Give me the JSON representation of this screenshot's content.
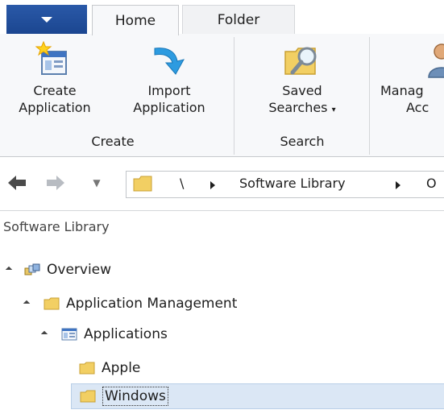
{
  "ribbon": {
    "tabs": [
      "Home",
      "Folder"
    ],
    "buttons": {
      "create_application": [
        "Create",
        "Application"
      ],
      "import_application": [
        "Import",
        "Application"
      ],
      "saved_searches": [
        "Saved",
        "Searches"
      ],
      "manage_access": [
        "Manag",
        "Acc"
      ]
    },
    "groups": [
      "Create",
      "Search"
    ]
  },
  "address_bar": {
    "root": "\\",
    "crumbs": [
      "Software Library",
      "O"
    ]
  },
  "navigation": {
    "title": "Software Library",
    "items": {
      "overview": "Overview",
      "application_management": "Application Management",
      "applications": "Applications",
      "apple": "Apple",
      "windows": "Windows"
    }
  },
  "colors": {
    "file_tab": "#1b4690",
    "selection": "#dbe7f5",
    "folder": "#f2cf63"
  }
}
